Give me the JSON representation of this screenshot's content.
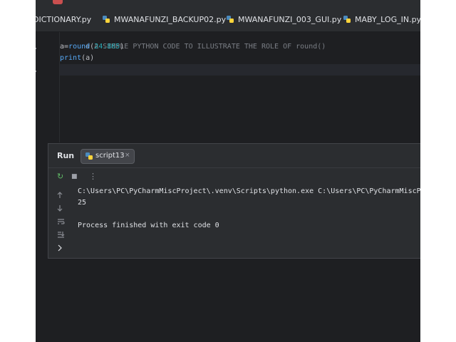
{
  "tabs": [
    {
      "label": "DICTIONARY.py",
      "cropped": true
    },
    {
      "label": "MWANAFUNZI_BACKUP02.py"
    },
    {
      "label": "MWANAFUNZI_003_GUI.py"
    },
    {
      "label": "MABY_LOG_IN.py"
    }
  ],
  "editor": {
    "lines": [
      {
        "text": "# A SIMPLE PYTHON CODE TO ILLUSTRATE THE ROLE OF round()"
      },
      {
        "prefix": "a=",
        "fn": "round",
        "open": "(",
        "num": "24.865",
        "close": ")"
      },
      {
        "fn": "print",
        "args": "(a)"
      },
      {
        "text": ""
      }
    ]
  },
  "run": {
    "title": "Run",
    "tab_label": "script13",
    "close_glyph": "×",
    "toolbar": {
      "rerun": "↻",
      "stop": "■",
      "more": "⋮"
    },
    "console": [
      "C:\\Users\\PC\\PyCharmMiscProject\\.venv\\Scripts\\python.exe C:\\Users\\PC\\PyCharmMiscProject",
      "25",
      "",
      "Process finished with exit code 0"
    ]
  },
  "colors": {
    "editor_bg": "#1e1f22",
    "panel_bg": "#2b2d30",
    "comment": "#7a7e85",
    "number": "#2aacb8",
    "function": "#56a8f5",
    "text": "#bcbec4"
  }
}
